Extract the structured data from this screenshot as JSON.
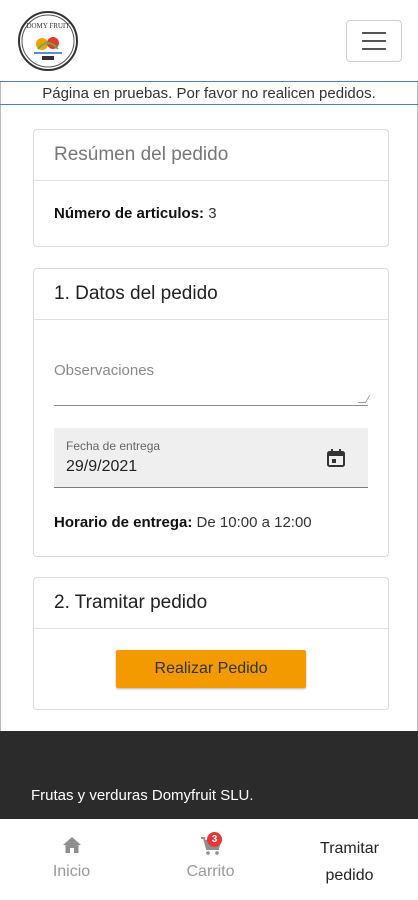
{
  "header": {
    "logo_text": "DOMY FRUIT",
    "menu_icon": "hamburger-menu-icon"
  },
  "banner": {
    "text": "Página en pruebas. Por favor no realicen pedidos."
  },
  "summary": {
    "title": "Resúmen del pedido",
    "items_label": "Número de articulos:",
    "items_value": "3"
  },
  "datos": {
    "title": "1. Datos del pedido",
    "observations_placeholder": "Observaciones",
    "delivery_date_label": "Fecha de entrega",
    "delivery_date_value": "29/9/2021",
    "calendar_icon": "calendar-icon",
    "schedule_label": "Horario de entrega:",
    "schedule_value": "De 10:00 a 12:00"
  },
  "tramitar": {
    "title": "2. Tramitar pedido",
    "submit_label": "Realizar Pedido"
  },
  "footer": {
    "company": "Frutas y verduras Domyfruit SLU."
  },
  "bottom_nav": {
    "items": [
      {
        "label": "Inicio",
        "icon": "home-icon"
      },
      {
        "label": "Carrito",
        "icon": "cart-icon",
        "badge": "3"
      },
      {
        "label": "Tramitar pedido",
        "line1": "Tramitar",
        "line2": "pedido"
      }
    ]
  },
  "colors": {
    "accent": "#f29a00",
    "footer_bg": "#2b2b2b",
    "badge": "#e53935",
    "header_border": "#4a7bd0"
  }
}
